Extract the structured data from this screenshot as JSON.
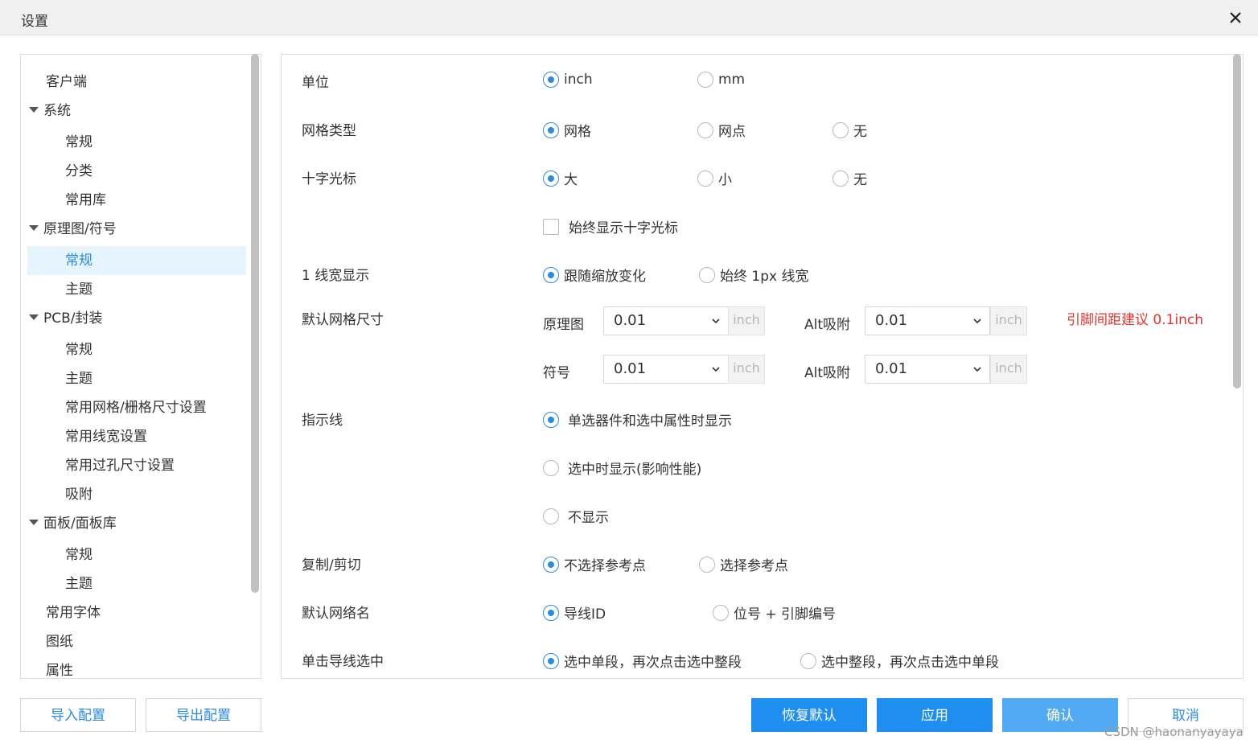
{
  "window": {
    "title": "设置"
  },
  "sidebar": {
    "items": [
      {
        "label": "客户端"
      },
      {
        "label": "系统"
      },
      {
        "label": "常规"
      },
      {
        "label": "分类"
      },
      {
        "label": "常用库"
      },
      {
        "label": "原理图/符号"
      },
      {
        "label": "常规"
      },
      {
        "label": "主题"
      },
      {
        "label": "PCB/封装"
      },
      {
        "label": "常规"
      },
      {
        "label": "主题"
      },
      {
        "label": "常用网格/栅格尺寸设置"
      },
      {
        "label": "常用线宽设置"
      },
      {
        "label": "常用过孔尺寸设置"
      },
      {
        "label": "吸附"
      },
      {
        "label": "面板/面板库"
      },
      {
        "label": "常规"
      },
      {
        "label": "主题"
      },
      {
        "label": "常用字体"
      },
      {
        "label": "图纸"
      },
      {
        "label": "属性"
      }
    ]
  },
  "settings": {
    "unit": {
      "label": "单位",
      "options": [
        "inch",
        "mm"
      ],
      "selected": "inch"
    },
    "grid_type": {
      "label": "网格类型",
      "options": [
        "网格",
        "网点",
        "无"
      ],
      "selected": "网格"
    },
    "crosshair": {
      "label": "十字光标",
      "options": [
        "大",
        "小",
        "无"
      ],
      "selected": "大",
      "always_show_label": "始终显示十字光标",
      "always_show_checked": false
    },
    "line_width": {
      "label": "1 线宽显示",
      "options": [
        "跟随缩放变化",
        "始终 1px 线宽"
      ],
      "selected": "跟随缩放变化"
    },
    "default_grid": {
      "label": "默认网格尺寸",
      "schematic_label": "原理图",
      "schematic_value": "0.01",
      "schematic_unit": "inch",
      "schematic_alt_label": "Alt吸附",
      "schematic_alt_value": "0.01",
      "schematic_alt_unit": "inch",
      "symbol_label": "符号",
      "symbol_value": "0.01",
      "symbol_unit": "inch",
      "symbol_alt_label": "Alt吸附",
      "symbol_alt_value": "0.01",
      "symbol_alt_unit": "inch",
      "hint": "引脚间距建议 0.1inch"
    },
    "indicator": {
      "label": "指示线",
      "options": [
        "单选器件和选中属性时显示",
        "选中时显示(影响性能)",
        "不显示"
      ],
      "selected": "单选器件和选中属性时显示"
    },
    "copy_cut": {
      "label": "复制/剪切",
      "options": [
        "不选择参考点",
        "选择参考点"
      ],
      "selected": "不选择参考点"
    },
    "default_net": {
      "label": "默认网络名",
      "options": [
        "导线ID",
        "位号 + 引脚编号"
      ],
      "selected": "导线ID"
    },
    "wire_select": {
      "label": "单击导线选中",
      "options": [
        "选中单段，再次点击选中整段",
        "选中整段，再次点击选中单段"
      ],
      "selected": "选中单段，再次点击选中整段"
    }
  },
  "footer": {
    "import": "导入配置",
    "export": "导出配置",
    "restore": "恢复默认",
    "apply": "应用",
    "confirm": "确认",
    "cancel": "取消",
    "watermark": "CSDN @haonanyayaya"
  },
  "colors": {
    "accent": "#1e8ef0",
    "selected_bg": "#e6f4fd",
    "hint": "#e5322d"
  }
}
